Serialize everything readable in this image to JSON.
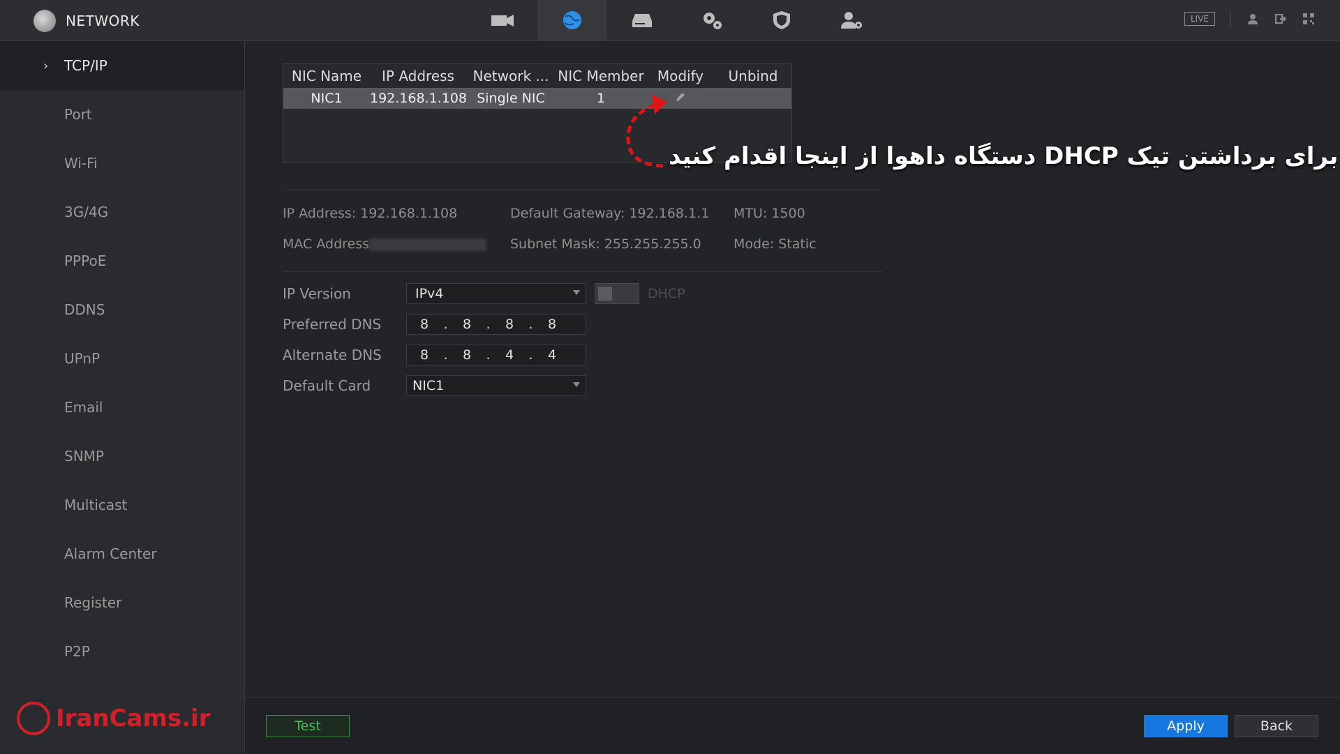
{
  "header": {
    "title": "NETWORK",
    "nav_icons": [
      "camera-icon",
      "network-globe-icon",
      "storage-icon",
      "settings-gears-icon",
      "security-shield-icon",
      "account-icon"
    ],
    "live_label": "LIVE",
    "right_icons": [
      "user-icon",
      "logout-icon",
      "qr-code-icon"
    ]
  },
  "sidebar": {
    "items": [
      {
        "label": "TCP/IP"
      },
      {
        "label": "Port"
      },
      {
        "label": "Wi-Fi"
      },
      {
        "label": "3G/4G"
      },
      {
        "label": "PPPoE"
      },
      {
        "label": "DDNS"
      },
      {
        "label": "UPnP"
      },
      {
        "label": "Email"
      },
      {
        "label": "SNMP"
      },
      {
        "label": "Multicast"
      },
      {
        "label": "Alarm Center"
      },
      {
        "label": "Register"
      },
      {
        "label": "P2P"
      }
    ],
    "active": "TCP/IP"
  },
  "brand": {
    "label": "IranCams.ir"
  },
  "nic_table": {
    "headers": [
      "NIC Name",
      "IP Address",
      "Network ...",
      "NIC Member",
      "Modify",
      "Unbind"
    ],
    "rows": [
      {
        "name": "NIC1",
        "ip": "192.168.1.108",
        "network": "Single NIC",
        "member": "1"
      }
    ]
  },
  "info": {
    "ip_address": "IP Address: 192.168.1.108",
    "mac_address_label": "MAC Address",
    "default_gateway": "Default Gateway: 192.168.1.1",
    "subnet_mask": "Subnet Mask: 255.255.255.0",
    "mtu": "MTU: 1500",
    "mode": "Mode: Static"
  },
  "form": {
    "ip_version_label": "IP Version",
    "ip_version_value": "IPv4",
    "dhcp_label": "DHCP",
    "preferred_dns_label": "Preferred DNS",
    "preferred_dns": [
      "8",
      "8",
      "8",
      "8"
    ],
    "alternate_dns_label": "Alternate DNS",
    "alternate_dns": [
      "8",
      "8",
      "4",
      "4"
    ],
    "default_card_label": "Default Card",
    "default_card_value": "NIC1"
  },
  "annotation": "برای برداشتن تیک DHCP دستگاه داهوا از اینجا اقدام کنید",
  "footer": {
    "test_label": "Test",
    "apply_label": "Apply",
    "back_label": "Back"
  }
}
